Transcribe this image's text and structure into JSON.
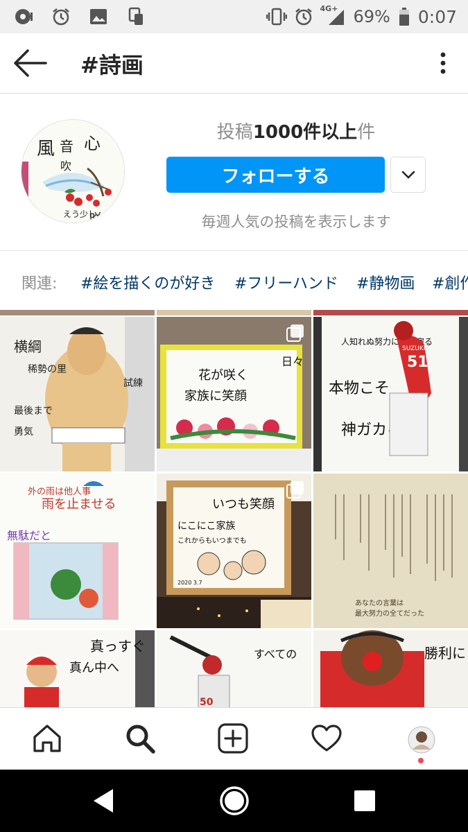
{
  "status_bar": {
    "battery_percent": "69%",
    "time": "0:07",
    "network_label": "4G+",
    "left_icons": [
      "notification-icon",
      "alarm-icon",
      "image-icon",
      "sim-icon"
    ],
    "right_icons": [
      "vibrate-icon",
      "alarm-icon",
      "signal-icon",
      "battery-icon"
    ]
  },
  "app_bar": {
    "title": "#詩画",
    "back_icon": "arrow-left-icon",
    "more_icon": "more-vertical-icon"
  },
  "header": {
    "post_count_prefix": "投稿",
    "post_count_value": "1000件以上",
    "post_count_suffix": "件",
    "follow_label": "フォローする",
    "dropdown_icon": "chevron-down-icon",
    "weekly_text": "毎週人気の投稿を表示します"
  },
  "related": {
    "label": "関連:",
    "tags": [
      "#絵を描くのが好き",
      "#フリーハンド",
      "#静物画",
      "#創作"
    ]
  },
  "grid": {
    "tiles": [
      {
        "id": "sumo",
        "multi": false,
        "text": [
          "横綱",
          "稀勢の里",
          "試練",
          "最後まで",
          "勇気"
        ]
      },
      {
        "id": "flowers",
        "multi": true,
        "text": [
          "日々",
          "花が咲く",
          "家族に笑顔"
        ]
      },
      {
        "id": "baseball-51",
        "multi": false,
        "text": [
          "人知れぬ努力に神が宿る",
          "本物こそ",
          "神ガカる",
          "51",
          "SUZUKI"
        ]
      },
      {
        "id": "rain",
        "multi": false,
        "text": [
          "雨を止ませる",
          "無駄だと",
          "外の雨は他人事"
        ]
      },
      {
        "id": "family",
        "multi": true,
        "text": [
          "いつも笑顔",
          "にこにこ家族",
          "これからもいつまでも",
          "2020 3.7"
        ]
      },
      {
        "id": "poem-text",
        "multi": false,
        "text": [
          "あなたの言葉は",
          "最大努力の全てだった"
        ]
      },
      {
        "id": "carp-1",
        "multi": false,
        "text": [
          "真っすぐ",
          "真ん中へ"
        ]
      },
      {
        "id": "batter",
        "multi": false,
        "text": [
          "すべての",
          "50"
        ]
      },
      {
        "id": "carp-2",
        "multi": false,
        "text": [
          "勝利に"
        ]
      }
    ]
  },
  "bottom_nav": {
    "items": [
      "home-icon",
      "search-icon",
      "add-post-icon",
      "activity-heart-icon",
      "profile-avatar"
    ]
  },
  "system_nav": {
    "items": [
      "back-triangle-icon",
      "home-circle-icon",
      "recents-square-icon"
    ]
  },
  "colors": {
    "follow_button": "#0095f6",
    "tag_link": "#00376b",
    "secondary_text": "#8e8e8e",
    "notification_dot": "#ed4956"
  }
}
